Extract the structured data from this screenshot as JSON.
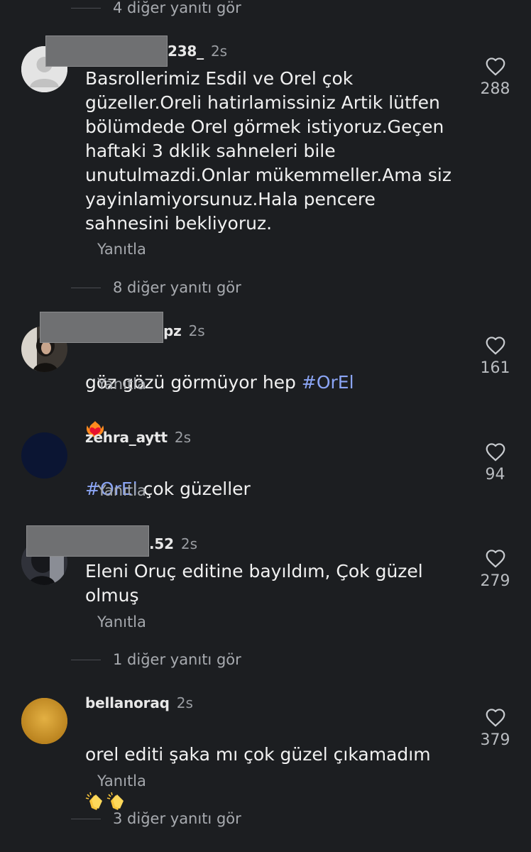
{
  "top_more_replies": "4 diğer yanıtı gör",
  "comments": [
    {
      "username_suffix": "238_",
      "time": "2s",
      "text": "Basrollerimiz Esdil ve Orel çok güzeller.Oreli hatirlamissiniz Artik lütfen bölümdede Orel görmek istiyoruz.Geçen haftaki 3 dklik sahneleri bile unutulmazdi.Onlar mükemmeller.Ama siz yayinlamiyorsunuz.Hala pencere sahnesini bekliyoruz.",
      "reply": "Yanıtla",
      "likes": "288",
      "more_replies": "8 diğer yanıtı gör"
    },
    {
      "username_suffix": "pz",
      "time": "2s",
      "text_before": "göz gözü görmüyor hep ",
      "hashtag": "#OrEl",
      "reply": "Yanıtla",
      "likes": "161"
    },
    {
      "username": "zehra_aytt",
      "time": "2s",
      "hashtag": "#OrEl",
      "text_after": " çok güzeller",
      "reply": "Yanıtla",
      "likes": "94"
    },
    {
      "username_suffix": ".52",
      "time": "2s",
      "text": "Eleni Oruç editine bayıldım, Çok güzel olmuş",
      "reply": "Yanıtla",
      "likes": "279",
      "more_replies": "1 diğer yanıtı gör"
    },
    {
      "username": "bellanoraq",
      "time": "2s",
      "text": "orel editi şaka mı çok güzel çıkamadım",
      "reply": "Yanıtla",
      "likes": "379",
      "more_replies": "3 diğer yanıtı gör"
    }
  ],
  "icons": {
    "like": "heart-outline-icon",
    "heart_emoji": "red-heart-emoji",
    "fire_heart_emoji": "heart-on-fire-emoji",
    "clap_emoji": "clapping-hands-emoji"
  },
  "colors": {
    "background": "#1c1e21",
    "hashtag": "#8ba5f5",
    "muted": "#a8abb0",
    "redaction": "#6f7072"
  }
}
